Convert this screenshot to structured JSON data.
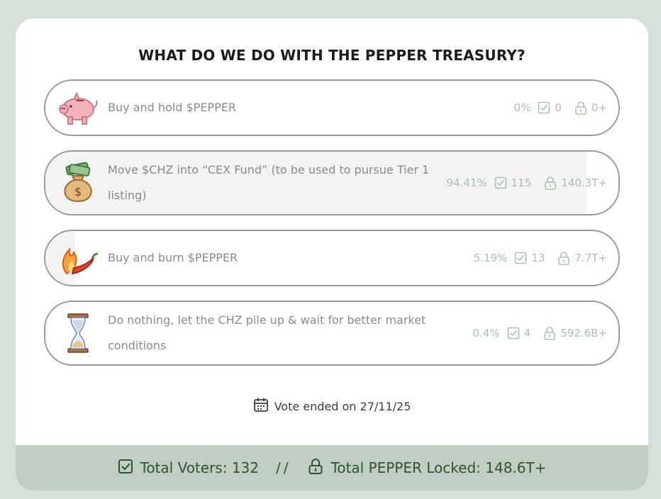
{
  "title": "WHAT DO WE DO WITH THE PEPPER TREASURY?",
  "options": [
    {
      "label": "Buy and hold $PEPPER",
      "percent": "0%",
      "votes": "0",
      "locked": "0+",
      "share": 0.0,
      "icon": "piggy-bank-icon"
    },
    {
      "label": "Move $CHZ into “CEX Fund” (to be used to pursue Tier 1 listing)",
      "percent": "94.41%",
      "votes": "115",
      "locked": "140.3T+",
      "share": 0.9441,
      "icon": "money-bag-icon"
    },
    {
      "label": "Buy and burn $PEPPER",
      "percent": "5.19%",
      "votes": "13",
      "locked": "7.7T+",
      "share": 0.0519,
      "icon": "flaming-pepper-icon"
    },
    {
      "label": "Do nothing, let the CHZ pile up & wait for better market conditions",
      "percent": "0.4%",
      "votes": "4",
      "locked": "592.6B+",
      "share": 0.004,
      "icon": "hourglass-icon"
    }
  ],
  "vote_ended": "Vote ended on 27/11/25",
  "footer": {
    "voters": "Total Voters: 132",
    "separator": "//",
    "locked": "Total PEPPER Locked: 148.6T+"
  },
  "colors": {
    "page_bg": "#d6e0d8",
    "footer_bg": "#c0cdc3",
    "footer_text": "#2f5236",
    "stat_text": "#a9c0ae",
    "option_border": "#9a9a9a"
  }
}
